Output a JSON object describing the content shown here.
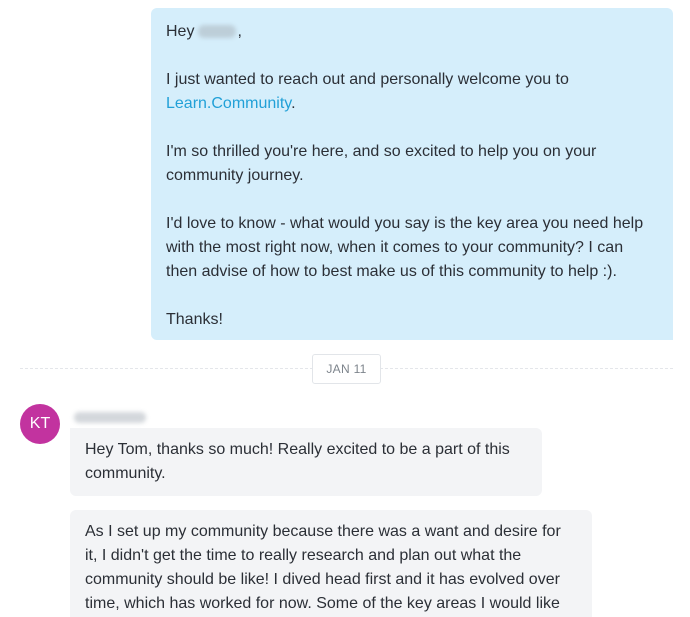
{
  "conversation": {
    "outgoing": {
      "greeting": "Hey",
      "greeting_punct": ",",
      "p1_before_link": "I just wanted to reach out and personally welcome you to ",
      "link_text": "Learn.Community",
      "p1_after_link": ".",
      "p2": "I'm so thrilled you're here, and so excited to help you on your community journey.",
      "p3": "I'd love to know - what would you say is the key area you need help with the most right now, when it comes to your community? I can then advise of how to best make us of this community to help :).",
      "p4": "Thanks!"
    },
    "date_separator": "JAN 11",
    "incoming": {
      "avatar_initials": "KT",
      "avatar_color": "#c2339f",
      "messages": [
        "Hey Tom, thanks so much! Really excited to be a part of this community.",
        "As I set up my community because there was a want and desire for it, I didn't get the time to really research and plan out what the community should be like! I dived head first and it has evolved over time, which has worked for now. Some of the key areas I would like"
      ]
    }
  },
  "colors": {
    "outgoing_bubble": "#d5eefb",
    "incoming_bubble": "#f3f4f6",
    "link": "#21a0d7"
  }
}
